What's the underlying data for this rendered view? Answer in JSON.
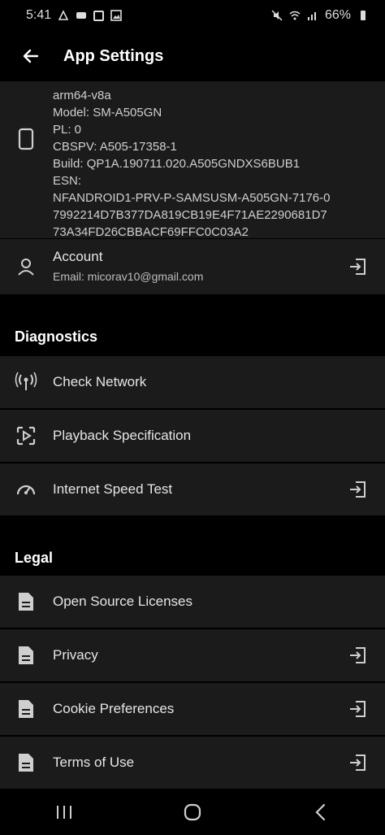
{
  "status": {
    "time": "5:41",
    "battery": "66%"
  },
  "appbar": {
    "title": "App Settings"
  },
  "device": {
    "lines": [
      "arm64-v8a",
      "Model: SM-A505GN",
      "PL: 0",
      "CBSPV: A505-17358-1",
      "Build: QP1A.190711.020.A505GNDXS6BUB1",
      "ESN:",
      "NFANDROID1-PRV-P-SAMSUSM-A505GN-7176-0",
      "7992214D7B377DA819CB19E4F71AE2290681D7",
      "73A34FD26CBBACF69FFC0C03A2"
    ]
  },
  "account": {
    "label": "Account",
    "email": "Email: micorav10@gmail.com"
  },
  "diagnostics": {
    "title": "Diagnostics",
    "items": [
      {
        "label": "Check Network"
      },
      {
        "label": "Playback Specification"
      },
      {
        "label": "Internet Speed Test"
      }
    ]
  },
  "legal": {
    "title": "Legal",
    "items": [
      {
        "label": "Open Source Licenses"
      },
      {
        "label": "Privacy"
      },
      {
        "label": "Cookie Preferences"
      },
      {
        "label": "Terms of Use"
      }
    ]
  },
  "icons": {
    "back": "arrow-left-icon",
    "device": "phone-icon",
    "account": "person-icon",
    "external": "exit-icon",
    "network": "antenna-icon",
    "playback": "video-frame-icon",
    "speed": "speedometer-icon",
    "document": "document-icon"
  }
}
